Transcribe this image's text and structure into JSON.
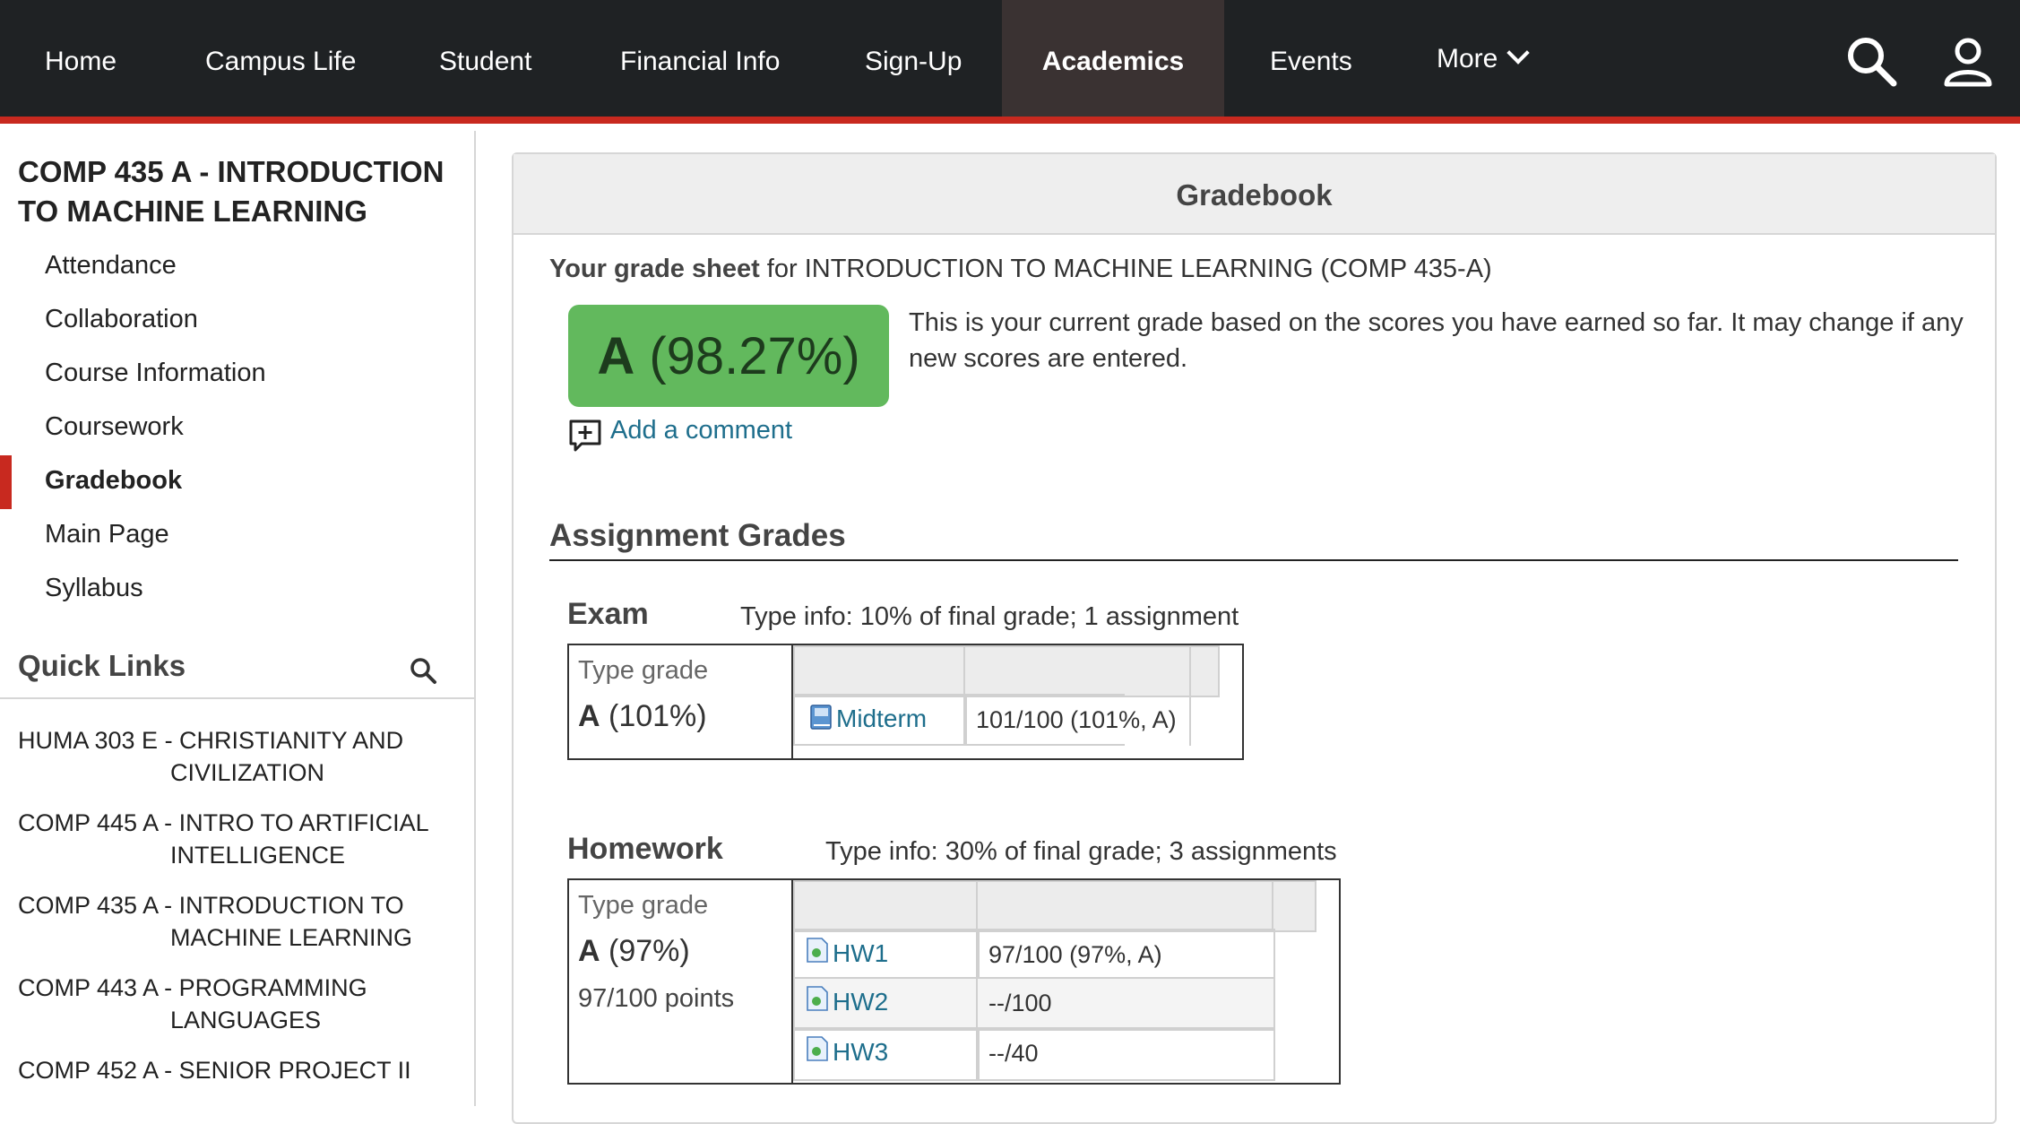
{
  "nav": {
    "items": [
      "Home",
      "Campus Life",
      "Student",
      "Financial Info",
      "Sign-Up",
      "Academics",
      "Events"
    ],
    "more_label": "More",
    "active": "Academics"
  },
  "sidebar": {
    "course_title": "COMP 435 A - INTRODUCTION TO MACHINE LEARNING",
    "links": [
      "Attendance",
      "Collaboration",
      "Course Information",
      "Coursework",
      "Gradebook",
      "Main Page",
      "Syllabus"
    ],
    "active_link": "Gradebook",
    "quick_links_title": "Quick Links",
    "quick_links": [
      "HUMA 303 E - CHRISTIANITY AND CIVILIZATION",
      "COMP 445 A - INTRO TO ARTIFICIAL INTELLIGENCE",
      "COMP 435 A - INTRODUCTION TO MACHINE LEARNING",
      "COMP 443 A - PROGRAMMING LANGUAGES",
      "COMP 452 A - SENIOR PROJECT II"
    ]
  },
  "gradebook": {
    "panel_title": "Gradebook",
    "sheet_bold": "Your grade sheet",
    "sheet_rest": " for INTRODUCTION TO MACHINE LEARNING (COMP 435-A)",
    "overall_letter": "A",
    "overall_pct": " (98.27%)",
    "grade_note": "This is your current grade based on the scores you have earned so far. It may change if any new scores are entered.",
    "comment_label": "Add a comment",
    "assignment_title": "Assignment Grades",
    "categories": [
      {
        "name": "Exam",
        "info": "Type info: 10% of final grade; 1 assignment",
        "type_label": "Type grade",
        "letter": "A",
        "pct": " (101%)",
        "points": "",
        "assignments": [
          {
            "name": "Midterm",
            "score": "101/100 (101%, A)"
          }
        ]
      },
      {
        "name": "Homework",
        "info": "Type info: 30% of final grade; 3 assignments",
        "type_label": "Type grade",
        "letter": "A",
        "pct": " (97%)",
        "points": "97/100 points",
        "assignments": [
          {
            "name": "HW1",
            "score": "97/100 (97%, A)"
          },
          {
            "name": "HW2",
            "score": "--/100"
          },
          {
            "name": "HW3",
            "score": "--/40"
          }
        ]
      }
    ]
  },
  "colors": {
    "nav_bg": "#1f2224",
    "accent_red": "#c8291f",
    "grade_green": "#62b95d",
    "link_blue": "#1e6e8c"
  }
}
